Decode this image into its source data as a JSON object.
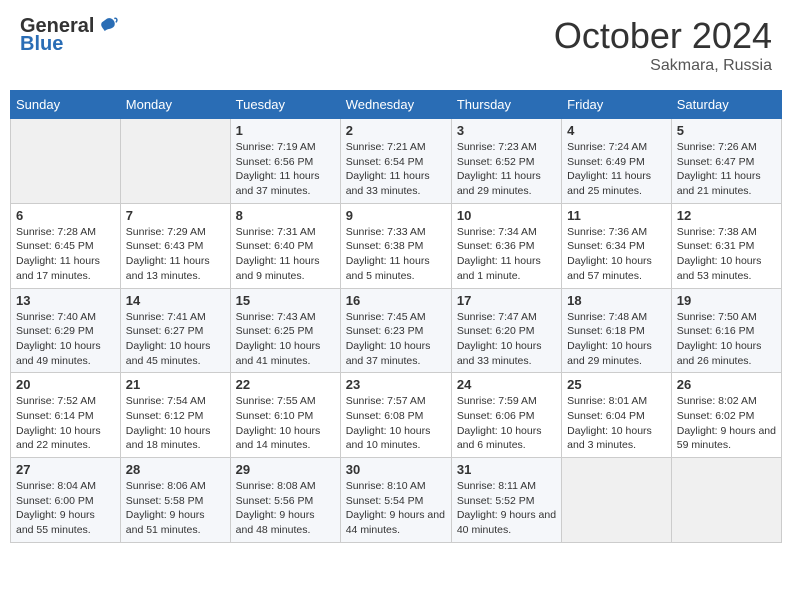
{
  "header": {
    "logo_general": "General",
    "logo_blue": "Blue",
    "month_title": "October 2024",
    "location": "Sakmara, Russia"
  },
  "days_of_week": [
    "Sunday",
    "Monday",
    "Tuesday",
    "Wednesday",
    "Thursday",
    "Friday",
    "Saturday"
  ],
  "weeks": [
    [
      {
        "day": "",
        "content": ""
      },
      {
        "day": "",
        "content": ""
      },
      {
        "day": "1",
        "content": "Sunrise: 7:19 AM\nSunset: 6:56 PM\nDaylight: 11 hours and 37 minutes."
      },
      {
        "day": "2",
        "content": "Sunrise: 7:21 AM\nSunset: 6:54 PM\nDaylight: 11 hours and 33 minutes."
      },
      {
        "day": "3",
        "content": "Sunrise: 7:23 AM\nSunset: 6:52 PM\nDaylight: 11 hours and 29 minutes."
      },
      {
        "day": "4",
        "content": "Sunrise: 7:24 AM\nSunset: 6:49 PM\nDaylight: 11 hours and 25 minutes."
      },
      {
        "day": "5",
        "content": "Sunrise: 7:26 AM\nSunset: 6:47 PM\nDaylight: 11 hours and 21 minutes."
      }
    ],
    [
      {
        "day": "6",
        "content": "Sunrise: 7:28 AM\nSunset: 6:45 PM\nDaylight: 11 hours and 17 minutes."
      },
      {
        "day": "7",
        "content": "Sunrise: 7:29 AM\nSunset: 6:43 PM\nDaylight: 11 hours and 13 minutes."
      },
      {
        "day": "8",
        "content": "Sunrise: 7:31 AM\nSunset: 6:40 PM\nDaylight: 11 hours and 9 minutes."
      },
      {
        "day": "9",
        "content": "Sunrise: 7:33 AM\nSunset: 6:38 PM\nDaylight: 11 hours and 5 minutes."
      },
      {
        "day": "10",
        "content": "Sunrise: 7:34 AM\nSunset: 6:36 PM\nDaylight: 11 hours and 1 minute."
      },
      {
        "day": "11",
        "content": "Sunrise: 7:36 AM\nSunset: 6:34 PM\nDaylight: 10 hours and 57 minutes."
      },
      {
        "day": "12",
        "content": "Sunrise: 7:38 AM\nSunset: 6:31 PM\nDaylight: 10 hours and 53 minutes."
      }
    ],
    [
      {
        "day": "13",
        "content": "Sunrise: 7:40 AM\nSunset: 6:29 PM\nDaylight: 10 hours and 49 minutes."
      },
      {
        "day": "14",
        "content": "Sunrise: 7:41 AM\nSunset: 6:27 PM\nDaylight: 10 hours and 45 minutes."
      },
      {
        "day": "15",
        "content": "Sunrise: 7:43 AM\nSunset: 6:25 PM\nDaylight: 10 hours and 41 minutes."
      },
      {
        "day": "16",
        "content": "Sunrise: 7:45 AM\nSunset: 6:23 PM\nDaylight: 10 hours and 37 minutes."
      },
      {
        "day": "17",
        "content": "Sunrise: 7:47 AM\nSunset: 6:20 PM\nDaylight: 10 hours and 33 minutes."
      },
      {
        "day": "18",
        "content": "Sunrise: 7:48 AM\nSunset: 6:18 PM\nDaylight: 10 hours and 29 minutes."
      },
      {
        "day": "19",
        "content": "Sunrise: 7:50 AM\nSunset: 6:16 PM\nDaylight: 10 hours and 26 minutes."
      }
    ],
    [
      {
        "day": "20",
        "content": "Sunrise: 7:52 AM\nSunset: 6:14 PM\nDaylight: 10 hours and 22 minutes."
      },
      {
        "day": "21",
        "content": "Sunrise: 7:54 AM\nSunset: 6:12 PM\nDaylight: 10 hours and 18 minutes."
      },
      {
        "day": "22",
        "content": "Sunrise: 7:55 AM\nSunset: 6:10 PM\nDaylight: 10 hours and 14 minutes."
      },
      {
        "day": "23",
        "content": "Sunrise: 7:57 AM\nSunset: 6:08 PM\nDaylight: 10 hours and 10 minutes."
      },
      {
        "day": "24",
        "content": "Sunrise: 7:59 AM\nSunset: 6:06 PM\nDaylight: 10 hours and 6 minutes."
      },
      {
        "day": "25",
        "content": "Sunrise: 8:01 AM\nSunset: 6:04 PM\nDaylight: 10 hours and 3 minutes."
      },
      {
        "day": "26",
        "content": "Sunrise: 8:02 AM\nSunset: 6:02 PM\nDaylight: 9 hours and 59 minutes."
      }
    ],
    [
      {
        "day": "27",
        "content": "Sunrise: 8:04 AM\nSunset: 6:00 PM\nDaylight: 9 hours and 55 minutes."
      },
      {
        "day": "28",
        "content": "Sunrise: 8:06 AM\nSunset: 5:58 PM\nDaylight: 9 hours and 51 minutes."
      },
      {
        "day": "29",
        "content": "Sunrise: 8:08 AM\nSunset: 5:56 PM\nDaylight: 9 hours and 48 minutes."
      },
      {
        "day": "30",
        "content": "Sunrise: 8:10 AM\nSunset: 5:54 PM\nDaylight: 9 hours and 44 minutes."
      },
      {
        "day": "31",
        "content": "Sunrise: 8:11 AM\nSunset: 5:52 PM\nDaylight: 9 hours and 40 minutes."
      },
      {
        "day": "",
        "content": ""
      },
      {
        "day": "",
        "content": ""
      }
    ]
  ]
}
